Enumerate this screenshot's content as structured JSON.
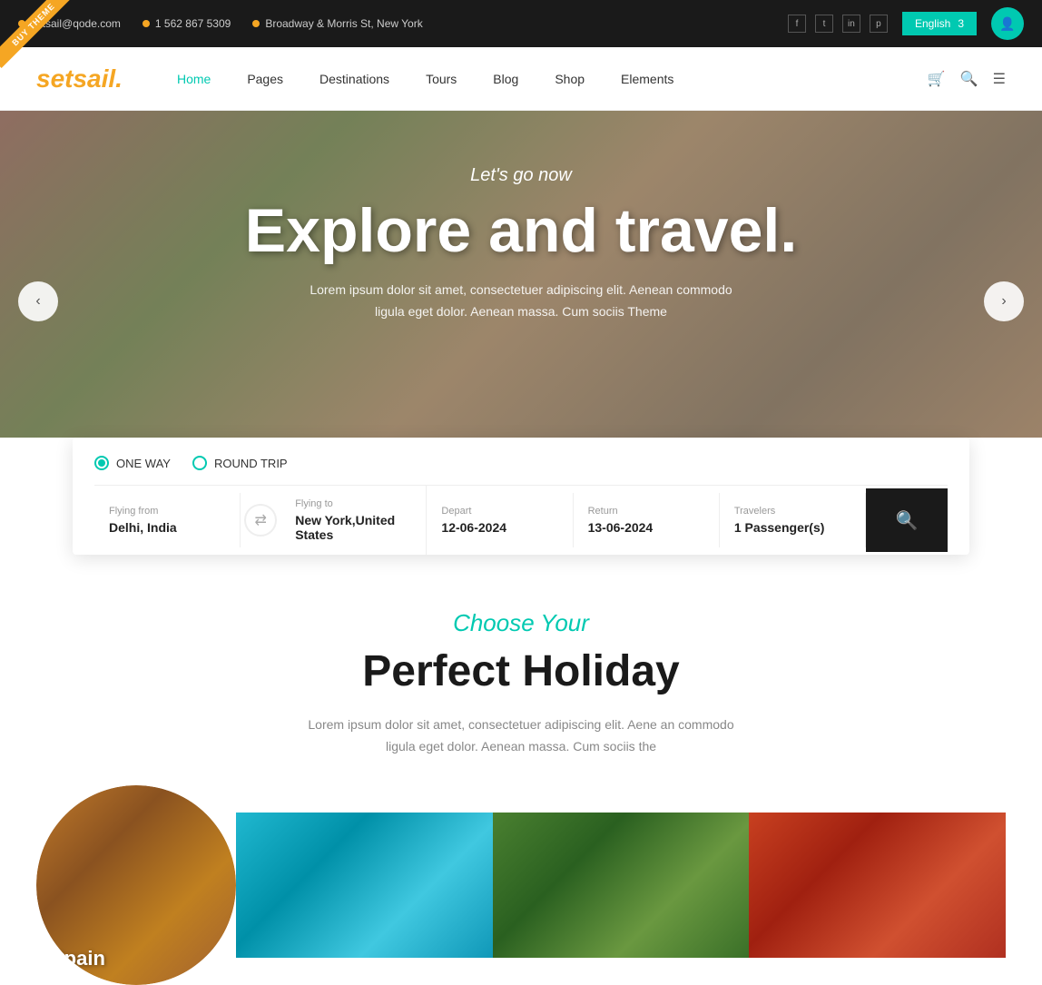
{
  "ribbon": {
    "label": "BUY THEME"
  },
  "topbar": {
    "email": "setsail@qode.com",
    "phone": "1 562 867 5309",
    "address": "Broadway & Morris St, New York",
    "lang": "English",
    "lang_count": "3"
  },
  "navbar": {
    "logo": "setsail.",
    "links": [
      {
        "label": "Home",
        "active": true
      },
      {
        "label": "Pages",
        "active": false
      },
      {
        "label": "Destinations",
        "active": false
      },
      {
        "label": "Tours",
        "active": false
      },
      {
        "label": "Blog",
        "active": false
      },
      {
        "label": "Shop",
        "active": false
      },
      {
        "label": "Elements",
        "active": false
      }
    ]
  },
  "hero": {
    "subtitle": "Let's go now",
    "title": "Explore and travel.",
    "description": "Lorem ipsum dolor sit amet, consectetuer adipiscing elit. Aenean commodo ligula eget dolor. Aenean massa. Cum sociis Theme"
  },
  "search": {
    "trip_type_1": "ONE WAY",
    "trip_type_2": "ROUND TRIP",
    "flying_from_label": "Flying from",
    "flying_from_value": "Delhi, India",
    "flying_to_label": "Flying to",
    "flying_to_value": "New York,United States",
    "depart_label": "Depart",
    "depart_value": "12-06-2024",
    "return_label": "Return",
    "return_value": "13-06-2024",
    "travelers_label": "Travelers",
    "travelers_value": "1 Passenger(s)",
    "search_icon": "🔍"
  },
  "choose": {
    "subtitle": "Choose Your",
    "title": "Perfect Holiday",
    "description": "Lorem ipsum dolor sit amet, consectetuer adipiscing elit. Aene an commodo ligula eget dolor. Aenean massa. Cum sociis the"
  },
  "destinations": [
    {
      "label": "Spain",
      "shape": "circle"
    },
    {
      "label": "",
      "shape": "rect"
    },
    {
      "label": "",
      "shape": "rect"
    },
    {
      "label": "",
      "shape": "rect"
    }
  ]
}
